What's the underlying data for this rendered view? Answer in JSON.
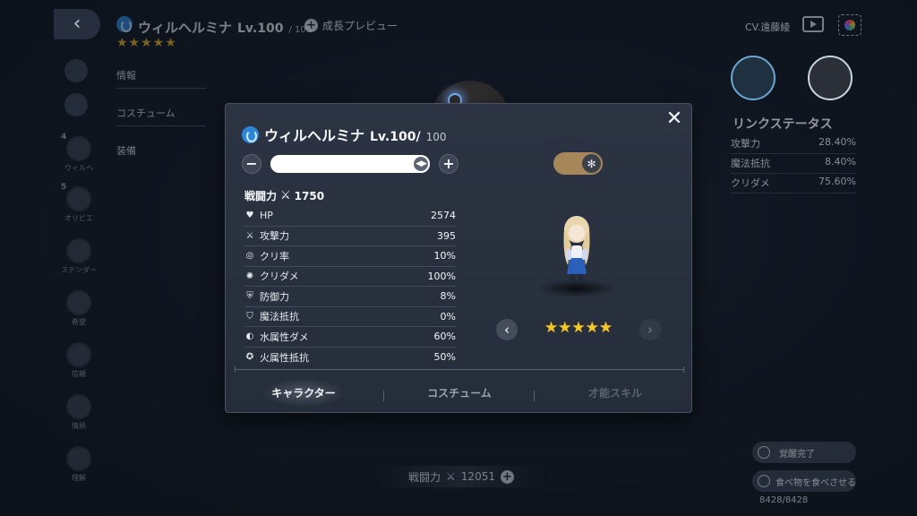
{
  "background": {
    "character_name": "ウィルヘルミナ",
    "level": "Lv.100",
    "level_max": "/ 100",
    "growth_preview": "成長プレビュー",
    "stars": "★★★★★",
    "cv_label": "CV.遠藤綾",
    "left_menu": [
      "情報",
      "コスチューム",
      "装備"
    ],
    "party": [
      {
        "num": "4",
        "name": "ウィルヘ"
      },
      {
        "num": "5",
        "name": "オリビエ"
      },
      {
        "num": "",
        "name": "ステンダー"
      },
      {
        "num": "",
        "name": "希望"
      },
      {
        "num": "",
        "name": "信頼"
      },
      {
        "num": "",
        "name": "情熱"
      },
      {
        "num": "",
        "name": "理解"
      }
    ],
    "link_status": {
      "title": "リンクステータス",
      "rows": [
        {
          "label": "攻撃力",
          "value": "28.40%"
        },
        {
          "label": "魔法抵抗",
          "value": "8.40%"
        },
        {
          "label": "クリダメ",
          "value": "75.60%"
        }
      ]
    },
    "awake_button": "覚醒完了",
    "feed_button": "食べ物を食べさせる",
    "feed_count": "8428/8428",
    "bottom_power_label": "戦闘力",
    "bottom_power_value": "12051"
  },
  "modal": {
    "name": "ウィルヘルミナ",
    "level": "Lv.100/",
    "level_max": "100",
    "level_fraction": 1.0,
    "power_label": "戦闘力",
    "power_value": "1750",
    "stars": "★★★★★",
    "element_color": "#2c86d8",
    "toggle_color": "#a5875a",
    "stats": [
      {
        "icon": "heart-icon",
        "glyph": "♥",
        "label": "HP",
        "value": "2574"
      },
      {
        "icon": "sword-icon",
        "glyph": "⚔",
        "label": "攻撃力",
        "value": "395"
      },
      {
        "icon": "crit-rate-icon",
        "glyph": "◎",
        "label": "クリ率",
        "value": "10%"
      },
      {
        "icon": "crit-damage-icon",
        "glyph": "✺",
        "label": "クリダメ",
        "value": "100%"
      },
      {
        "icon": "shield-icon",
        "glyph": "⛨",
        "label": "防御力",
        "value": "8%"
      },
      {
        "icon": "magic-shield-icon",
        "glyph": "⛉",
        "label": "魔法抵抗",
        "value": "0%"
      },
      {
        "icon": "water-damage-icon",
        "glyph": "◐",
        "label": "水属性ダメ",
        "value": "60%"
      },
      {
        "icon": "fire-resist-icon",
        "glyph": "✪",
        "label": "火属性抵抗",
        "value": "50%"
      }
    ],
    "tabs": [
      {
        "label": "キャラクター",
        "state": "active"
      },
      {
        "label": "コスチューム",
        "state": "normal"
      },
      {
        "label": "才能スキル",
        "state": "disabled"
      }
    ]
  }
}
